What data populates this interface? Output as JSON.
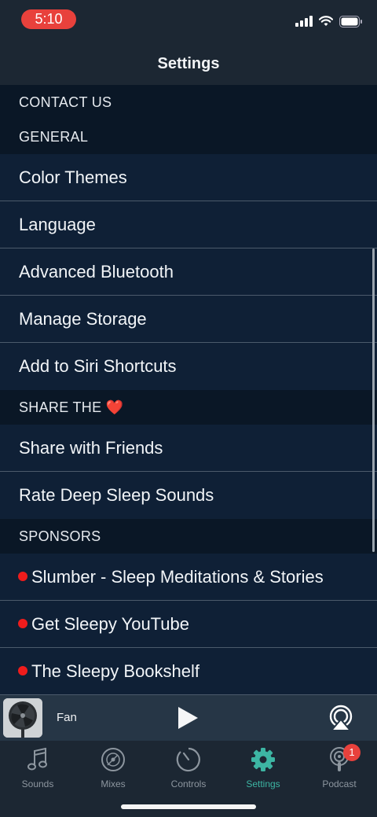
{
  "status": {
    "time": "5:10"
  },
  "header": {
    "title": "Settings"
  },
  "sections": {
    "contact": "CONTACT US",
    "general": "GENERAL",
    "share": "SHARE THE",
    "sponsors": "SPONSORS"
  },
  "general_items": [
    "Color Themes",
    "Language",
    "Advanced Bluetooth",
    "Manage Storage",
    "Add to Siri Shortcuts"
  ],
  "share_items": [
    "Share with Friends",
    "Rate Deep Sleep Sounds"
  ],
  "sponsor_items": [
    "Slumber - Sleep Meditations & Stories",
    "Get Sleepy YouTube",
    "The Sleepy Bookshelf"
  ],
  "player": {
    "track": "Fan"
  },
  "tabs": [
    {
      "label": "Sounds",
      "icon": "music-note-icon"
    },
    {
      "label": "Mixes",
      "icon": "disc-icon"
    },
    {
      "label": "Controls",
      "icon": "timer-icon"
    },
    {
      "label": "Settings",
      "icon": "gear-icon"
    },
    {
      "label": "Podcast",
      "icon": "podcast-icon",
      "badge": "1"
    }
  ],
  "colors": {
    "accent": "#3db5a3",
    "status_pill": "#e8413c",
    "sponsor_dot": "#ef1c1c"
  }
}
